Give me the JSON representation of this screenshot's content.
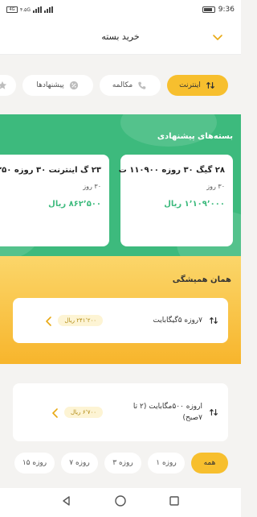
{
  "status": {
    "time": "9:36",
    "badge": "4G",
    "left_text": "۴.۵G"
  },
  "header": {
    "title": "خرید بسته"
  },
  "categories": [
    {
      "label": "اینترنت",
      "icon": "arrows-up-down-icon",
      "active": true
    },
    {
      "label": "مکالمه",
      "icon": "phone-icon",
      "active": false
    },
    {
      "label": "پیشنهادها",
      "icon": "percent-badge-icon",
      "active": false
    }
  ],
  "suggested": {
    "title": "بسته‌های پیشنهادی",
    "cards": [
      {
        "title": "۲۸ گیگ ۳۰ روزه ۱۱۰۹۰۰ ت",
        "days": "۳۰ روز",
        "price": "۱٬۱۰۹٬۰۰۰ ریال"
      },
      {
        "title": "۲۳ گ اینترنت ۳۰ روزه ۸۶۲۵۰",
        "days": "۳۰ روز",
        "price": "۸۶۲٬۵۰۰ ریال"
      }
    ]
  },
  "always": {
    "title": "همان همیشگی",
    "items": [
      {
        "name": "۷روزه ۵گیگابایت",
        "price": "۲۴۱٬۲۰۰ ریال"
      }
    ]
  },
  "list": {
    "items": [
      {
        "name": "اروزه ۵۰۰مگابایت (۲ تا ۷صبح)",
        "price": "۶٬۷۰۰ ریال"
      }
    ]
  },
  "filters": [
    {
      "label": "همه",
      "active": true
    },
    {
      "label": "۱ روزه",
      "active": false
    },
    {
      "label": "۳ روزه",
      "active": false
    },
    {
      "label": "۷ روزه",
      "active": false
    },
    {
      "label": "۱۵ روزه",
      "active": false
    }
  ],
  "colors": {
    "accent": "#f7bf2e",
    "green": "#3dba7d"
  }
}
